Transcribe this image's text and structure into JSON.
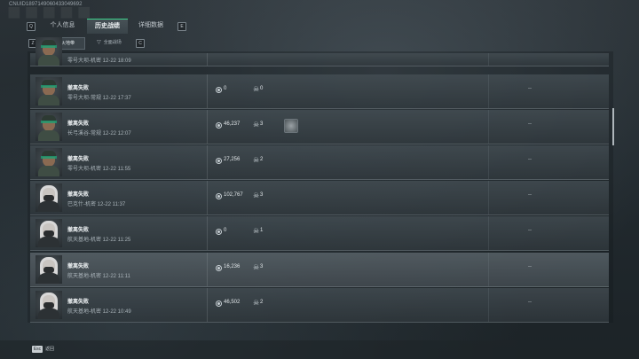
{
  "header": {
    "uid": "CNUID1897149060433049692"
  },
  "top_tabs": {
    "left_key": "Q",
    "right_key": "E",
    "items": [
      "个人信息",
      "历史战绩",
      "详细数据"
    ],
    "active": 1
  },
  "sub_tabs": {
    "left_key": "Z",
    "right_key": "C",
    "items": [
      "烽火地带",
      "全面战场"
    ],
    "active": 0
  },
  "rows": [
    {
      "avatar": "male",
      "result": "",
      "meta": "零号大坝-机密 12-22 18:09",
      "value": "",
      "kills": "",
      "item": false,
      "extra": ""
    },
    {
      "avatar": "male",
      "result": "撤离失败",
      "meta": "零号大坝-常规 12-22 17:37",
      "value": "0",
      "kills": "0",
      "item": false,
      "extra": "--"
    },
    {
      "avatar": "male",
      "result": "撤离失败",
      "meta": "长弓溪谷-常规 12-22 12:07",
      "value": "46,237",
      "kills": "3",
      "item": true,
      "extra": "--"
    },
    {
      "avatar": "male",
      "result": "撤离失败",
      "meta": "零号大坝-机密 12-22 11:55",
      "value": "27,256",
      "kills": "2",
      "item": false,
      "extra": "--"
    },
    {
      "avatar": "female",
      "result": "撤离失败",
      "meta": "巴克什-机密 12-22 11:37",
      "value": "102,767",
      "kills": "3",
      "item": false,
      "extra": "--"
    },
    {
      "avatar": "female",
      "result": "撤离失败",
      "meta": "航天基地-机密 12-22 11:25",
      "value": "0",
      "kills": "1",
      "item": false,
      "extra": "--"
    },
    {
      "avatar": "female",
      "result": "撤离失败",
      "meta": "航天基地-机密 12-22 11:11",
      "value": "16,236",
      "kills": "3",
      "item": false,
      "extra": "--"
    },
    {
      "avatar": "female",
      "result": "撤离失败",
      "meta": "航天基地-机密 12-22 10:49",
      "value": "46,502",
      "kills": "2",
      "item": false,
      "extra": "--"
    }
  ],
  "footer": {
    "esc_key": "Esc",
    "esc_label": "返回"
  },
  "colors": {
    "accent": "#3bd28b"
  }
}
